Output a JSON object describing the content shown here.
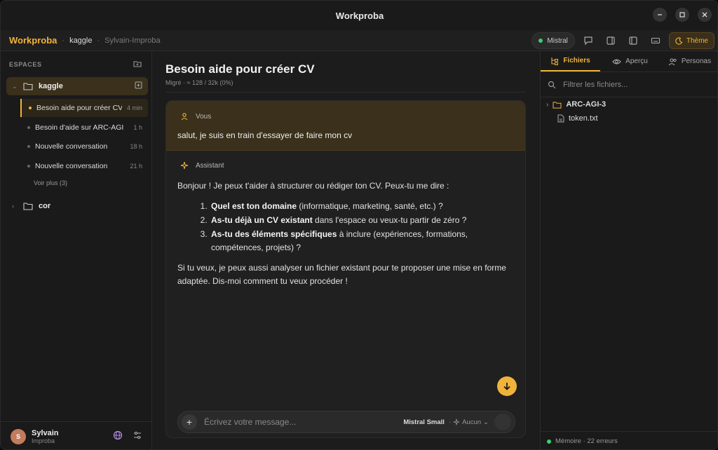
{
  "window": {
    "title": "Workproba"
  },
  "toolbar": {
    "brand": "Workproba",
    "breadcrumb": [
      "kaggle",
      "Sylvain-Improba"
    ],
    "model_pill": "Mistral",
    "theme_label": "Thème",
    "status_color": "#3ccf70",
    "accent_color": "#f0b43c"
  },
  "sidebar": {
    "heading": "ESPACES",
    "spaces": [
      {
        "name": "kaggle",
        "expanded": true,
        "conversations": [
          {
            "title": "Besoin aide pour créer CV",
            "time": "4 min",
            "active": true
          },
          {
            "title": "Besoin d'aide sur ARC-AGI",
            "time": "1 h",
            "active": false
          },
          {
            "title": "Nouvelle conversation",
            "time": "18 h",
            "active": false
          },
          {
            "title": "Nouvelle conversation",
            "time": "21 h",
            "active": false
          }
        ],
        "more_label": "Voir plus (3)"
      },
      {
        "name": "cor",
        "expanded": false
      }
    ],
    "user": {
      "initial": "S",
      "name": "Sylvain",
      "org": "Improba"
    }
  },
  "main": {
    "title": "Besoin aide pour créer CV",
    "meta": "Migré · ≈ 128 / 32k (0%)",
    "user_role": "Vous",
    "user_message": "salut, je suis en train d'essayer de faire mon cv",
    "assistant_role": "Assistant",
    "assistant": {
      "intro": "Bonjour ! Je peux t'aider à structurer ou rédiger ton CV. Peux-tu me dire :",
      "items": [
        {
          "bold": "Quel est ton domaine",
          "rest": " (informatique, marketing, santé, etc.) ?"
        },
        {
          "bold": "As-tu déjà un CV existant",
          "rest": " dans l'espace ou veux-tu partir de zéro ?"
        },
        {
          "bold": "As-tu des éléments spécifiques",
          "rest": " à inclure (expériences, formations, compétences, projets) ?"
        }
      ],
      "outro": "Si tu veux, je peux aussi analyser un fichier existant pour te proposer une mise en forme adaptée. Dis-moi comment tu veux procéder !"
    },
    "composer": {
      "placeholder": "Écrivez votre message...",
      "model": "Mistral Small",
      "tool": "Aucun"
    }
  },
  "rpanel": {
    "tabs": [
      {
        "label": "Fichiers",
        "icon": "file-tree-icon",
        "active": true
      },
      {
        "label": "Aperçu",
        "icon": "eye-icon",
        "active": false
      },
      {
        "label": "Personas",
        "icon": "users-icon",
        "active": false
      }
    ],
    "filter_placeholder": "Filtrer les fichiers...",
    "tree": [
      {
        "type": "folder",
        "name": "ARC-AGI-3"
      },
      {
        "type": "file",
        "name": "token.txt"
      }
    ],
    "footer": "Mémoire · 22 erreurs"
  }
}
